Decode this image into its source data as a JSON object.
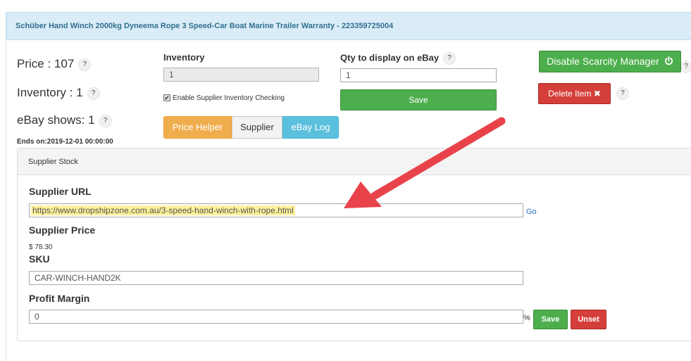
{
  "header": {
    "title": "Schüber Hand Winch 2000kg Dyneema Rope 3 Speed-Car Boat Marine Trailer Warranty - 223359725004"
  },
  "summary": {
    "price_label": "Price : 107",
    "inventory_label": "Inventory : 1",
    "ebay_shows_label": "eBay shows: 1",
    "help_mark": "?",
    "ends_on": "Ends on:2019-12-01 00:00:00"
  },
  "inventory": {
    "label": "Inventory",
    "value": "1",
    "checkbox_label": "Enable Supplier Inventory Checking",
    "checkbox_checked": true
  },
  "qty": {
    "label": "Qty to display on eBay",
    "value": "1",
    "save_label": "Save"
  },
  "tabs": {
    "price_helper": "Price Helper",
    "supplier": "Supplier",
    "ebay_log": "eBay Log"
  },
  "actions": {
    "disable_scarcity": "Disable Scarcity Manager",
    "delete_item": "Delete Item"
  },
  "supplier_stock": {
    "heading": "Supplier Stock",
    "url_label": "Supplier URL",
    "url_value": "https://www.dropshipzone.com.au/3-speed-hand-winch-with-rope.html",
    "go_label": "Go",
    "price_label": "Supplier Price",
    "price_value": "$ 78.30",
    "sku_label": "SKU",
    "sku_value": "CAR-WINCH-HAND2K",
    "margin_label": "Profit Margin",
    "margin_value": "0",
    "margin_unit": "%",
    "save_label": "Save",
    "unset_label": "Unset"
  },
  "colors": {
    "green": "#4cae4c",
    "red": "#d43f3a",
    "orange": "#f0ad4e",
    "blue": "#5bc0de",
    "heading_bg": "#d9ecf7",
    "highlight": "#fdf19a",
    "arrow": "#e8434b"
  },
  "icons": {
    "power": "power-icon",
    "times": "times-icon",
    "arrow": "annotation-arrow"
  }
}
